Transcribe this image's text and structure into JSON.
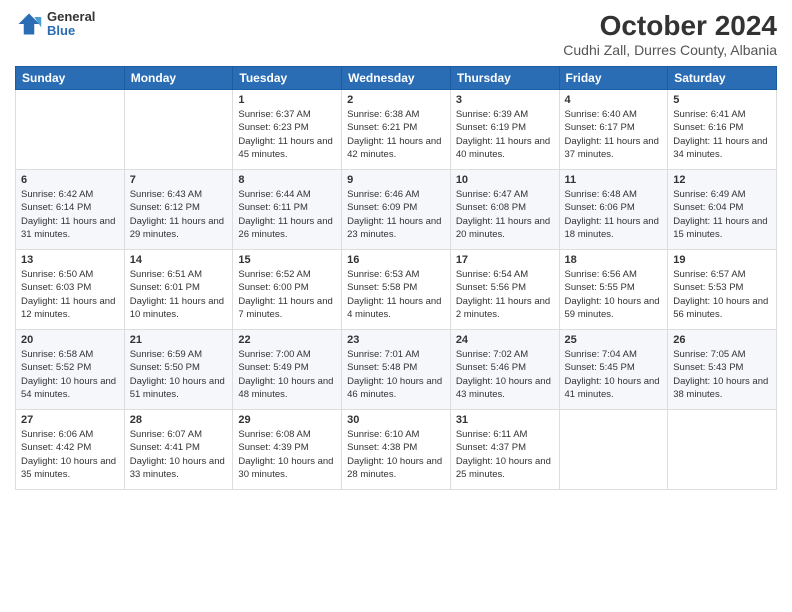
{
  "header": {
    "logo_general": "General",
    "logo_blue": "Blue",
    "month": "October 2024",
    "location": "Cudhi Zall, Durres County, Albania"
  },
  "days_of_week": [
    "Sunday",
    "Monday",
    "Tuesday",
    "Wednesday",
    "Thursday",
    "Friday",
    "Saturday"
  ],
  "weeks": [
    [
      {
        "day": "",
        "info": ""
      },
      {
        "day": "",
        "info": ""
      },
      {
        "day": "1",
        "info": "Sunrise: 6:37 AM\nSunset: 6:23 PM\nDaylight: 11 hours and 45 minutes."
      },
      {
        "day": "2",
        "info": "Sunrise: 6:38 AM\nSunset: 6:21 PM\nDaylight: 11 hours and 42 minutes."
      },
      {
        "day": "3",
        "info": "Sunrise: 6:39 AM\nSunset: 6:19 PM\nDaylight: 11 hours and 40 minutes."
      },
      {
        "day": "4",
        "info": "Sunrise: 6:40 AM\nSunset: 6:17 PM\nDaylight: 11 hours and 37 minutes."
      },
      {
        "day": "5",
        "info": "Sunrise: 6:41 AM\nSunset: 6:16 PM\nDaylight: 11 hours and 34 minutes."
      }
    ],
    [
      {
        "day": "6",
        "info": "Sunrise: 6:42 AM\nSunset: 6:14 PM\nDaylight: 11 hours and 31 minutes."
      },
      {
        "day": "7",
        "info": "Sunrise: 6:43 AM\nSunset: 6:12 PM\nDaylight: 11 hours and 29 minutes."
      },
      {
        "day": "8",
        "info": "Sunrise: 6:44 AM\nSunset: 6:11 PM\nDaylight: 11 hours and 26 minutes."
      },
      {
        "day": "9",
        "info": "Sunrise: 6:46 AM\nSunset: 6:09 PM\nDaylight: 11 hours and 23 minutes."
      },
      {
        "day": "10",
        "info": "Sunrise: 6:47 AM\nSunset: 6:08 PM\nDaylight: 11 hours and 20 minutes."
      },
      {
        "day": "11",
        "info": "Sunrise: 6:48 AM\nSunset: 6:06 PM\nDaylight: 11 hours and 18 minutes."
      },
      {
        "day": "12",
        "info": "Sunrise: 6:49 AM\nSunset: 6:04 PM\nDaylight: 11 hours and 15 minutes."
      }
    ],
    [
      {
        "day": "13",
        "info": "Sunrise: 6:50 AM\nSunset: 6:03 PM\nDaylight: 11 hours and 12 minutes."
      },
      {
        "day": "14",
        "info": "Sunrise: 6:51 AM\nSunset: 6:01 PM\nDaylight: 11 hours and 10 minutes."
      },
      {
        "day": "15",
        "info": "Sunrise: 6:52 AM\nSunset: 6:00 PM\nDaylight: 11 hours and 7 minutes."
      },
      {
        "day": "16",
        "info": "Sunrise: 6:53 AM\nSunset: 5:58 PM\nDaylight: 11 hours and 4 minutes."
      },
      {
        "day": "17",
        "info": "Sunrise: 6:54 AM\nSunset: 5:56 PM\nDaylight: 11 hours and 2 minutes."
      },
      {
        "day": "18",
        "info": "Sunrise: 6:56 AM\nSunset: 5:55 PM\nDaylight: 10 hours and 59 minutes."
      },
      {
        "day": "19",
        "info": "Sunrise: 6:57 AM\nSunset: 5:53 PM\nDaylight: 10 hours and 56 minutes."
      }
    ],
    [
      {
        "day": "20",
        "info": "Sunrise: 6:58 AM\nSunset: 5:52 PM\nDaylight: 10 hours and 54 minutes."
      },
      {
        "day": "21",
        "info": "Sunrise: 6:59 AM\nSunset: 5:50 PM\nDaylight: 10 hours and 51 minutes."
      },
      {
        "day": "22",
        "info": "Sunrise: 7:00 AM\nSunset: 5:49 PM\nDaylight: 10 hours and 48 minutes."
      },
      {
        "day": "23",
        "info": "Sunrise: 7:01 AM\nSunset: 5:48 PM\nDaylight: 10 hours and 46 minutes."
      },
      {
        "day": "24",
        "info": "Sunrise: 7:02 AM\nSunset: 5:46 PM\nDaylight: 10 hours and 43 minutes."
      },
      {
        "day": "25",
        "info": "Sunrise: 7:04 AM\nSunset: 5:45 PM\nDaylight: 10 hours and 41 minutes."
      },
      {
        "day": "26",
        "info": "Sunrise: 7:05 AM\nSunset: 5:43 PM\nDaylight: 10 hours and 38 minutes."
      }
    ],
    [
      {
        "day": "27",
        "info": "Sunrise: 6:06 AM\nSunset: 4:42 PM\nDaylight: 10 hours and 35 minutes."
      },
      {
        "day": "28",
        "info": "Sunrise: 6:07 AM\nSunset: 4:41 PM\nDaylight: 10 hours and 33 minutes."
      },
      {
        "day": "29",
        "info": "Sunrise: 6:08 AM\nSunset: 4:39 PM\nDaylight: 10 hours and 30 minutes."
      },
      {
        "day": "30",
        "info": "Sunrise: 6:10 AM\nSunset: 4:38 PM\nDaylight: 10 hours and 28 minutes."
      },
      {
        "day": "31",
        "info": "Sunrise: 6:11 AM\nSunset: 4:37 PM\nDaylight: 10 hours and 25 minutes."
      },
      {
        "day": "",
        "info": ""
      },
      {
        "day": "",
        "info": ""
      }
    ]
  ]
}
